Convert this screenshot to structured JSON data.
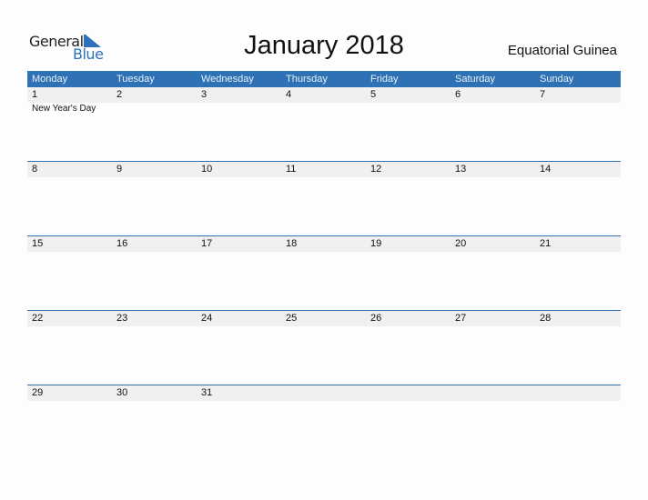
{
  "logo": {
    "word1": "General",
    "word2": "Blue"
  },
  "title": "January 2018",
  "country": "Equatorial Guinea",
  "weekdays": [
    "Monday",
    "Tuesday",
    "Wednesday",
    "Thursday",
    "Friday",
    "Saturday",
    "Sunday"
  ],
  "weeks": [
    {
      "days": [
        "1",
        "2",
        "3",
        "4",
        "5",
        "6",
        "7"
      ],
      "events": [
        "New Year's Day",
        "",
        "",
        "",
        "",
        "",
        ""
      ]
    },
    {
      "days": [
        "8",
        "9",
        "10",
        "11",
        "12",
        "13",
        "14"
      ],
      "events": [
        "",
        "",
        "",
        "",
        "",
        "",
        ""
      ]
    },
    {
      "days": [
        "15",
        "16",
        "17",
        "18",
        "19",
        "20",
        "21"
      ],
      "events": [
        "",
        "",
        "",
        "",
        "",
        "",
        ""
      ]
    },
    {
      "days": [
        "22",
        "23",
        "24",
        "25",
        "26",
        "27",
        "28"
      ],
      "events": [
        "",
        "",
        "",
        "",
        "",
        "",
        ""
      ]
    },
    {
      "days": [
        "29",
        "30",
        "31",
        "",
        "",
        "",
        ""
      ],
      "events": [
        "",
        "",
        "",
        "",
        "",
        "",
        ""
      ]
    }
  ],
  "colors": {
    "accent": "#2e72b5",
    "strip": "#f0f0f0"
  }
}
